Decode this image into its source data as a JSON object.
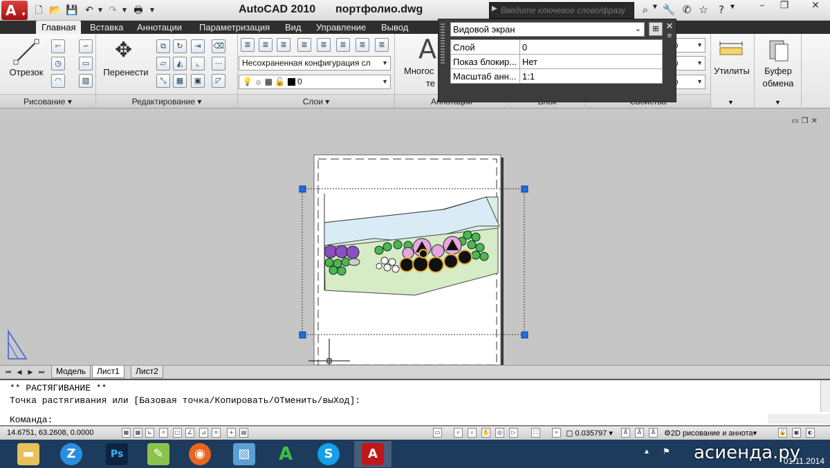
{
  "title_bar": {
    "app_title": "AutoCAD 2010",
    "doc_title": "портфолио.dwg",
    "search_placeholder": "Введите ключевое слово/фразу"
  },
  "ribbon_tabs": [
    "Главная",
    "Вставка",
    "Аннотации",
    "Параметризация",
    "Вид",
    "Управление",
    "Вывод"
  ],
  "ribbon": {
    "draw": {
      "line_label": "Отрезок",
      "panel_label": "Рисование"
    },
    "modify": {
      "move_label": "Перенести",
      "panel_label": "Редактирование"
    },
    "layers": {
      "layer_state": "Несохраненная конфигурация сл",
      "current_layer": "0",
      "panel_label": "Слои"
    },
    "annotation": {
      "mtext_label_partial": "Многос",
      "mtext_label_partial2": "те",
      "panel_label": "Аннотации"
    },
    "block": {
      "panel_label": "Блок"
    },
    "properties": {
      "combo1": "ою",
      "combo2": "ою",
      "panel_label": "Свойства"
    },
    "utilities": {
      "label": "Утилиты"
    },
    "clipboard": {
      "label_line1": "Буфер",
      "label_line2": "обмена"
    }
  },
  "properties_popup": {
    "object_type": "Видовой экран",
    "rows": [
      {
        "key": "Слой",
        "value": "0"
      },
      {
        "key": "Показ блокир...",
        "value": "Нет"
      },
      {
        "key": "Масштаб анн...",
        "value": "1:1"
      }
    ]
  },
  "layout_tabs": {
    "tabs": [
      "Модель",
      "Лист1",
      "Лист2"
    ],
    "active": "Лист1"
  },
  "command_line": {
    "line1": "** РАСТЯГИВАНИЕ **",
    "line2": "Точка растягивания или [Базовая точка/Копировать/ОТменить/выХод]:",
    "prompt": "Команда:"
  },
  "status_bar": {
    "coordinates": "14.6751, 63.2608, 0.0000",
    "scale": "0.035797",
    "workspace": "2D рисование и аннота"
  },
  "taskbar": {
    "apps": [
      "explorer",
      "zoom-z",
      "photoshop",
      "notepad",
      "firefox",
      "photo-viewer",
      "green-a",
      "skype",
      "autocad"
    ],
    "clock_date": "01.11.2014"
  },
  "watermark": "асиенда.ру",
  "colors": {
    "ribbon_tab_bg": "#2e2e2e",
    "grip_blue": "#1e6fe0",
    "taskbar": "#1d3b5c"
  }
}
